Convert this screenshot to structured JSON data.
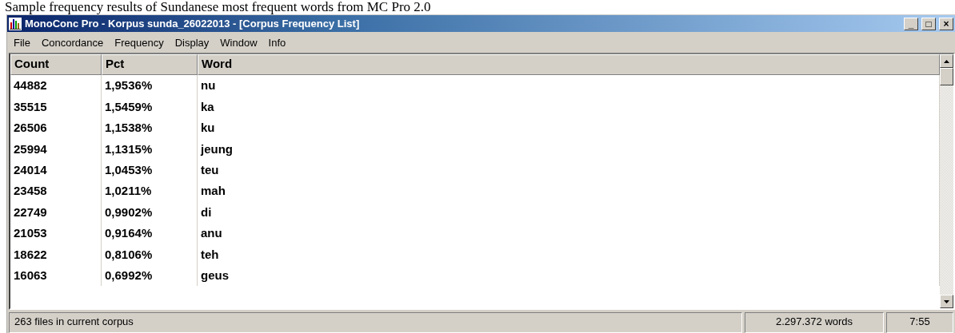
{
  "caption": "Sample frequency results of Sundanese most frequent words from MC Pro 2.0",
  "window": {
    "title": "MonoConc Pro - Korpus sunda_26022013 - [Corpus Frequency List]",
    "controls": [
      "_",
      "□",
      "×"
    ]
  },
  "menu": [
    "File",
    "Concordance",
    "Frequency",
    "Display",
    "Window",
    "Info"
  ],
  "table": {
    "columns": [
      "Count",
      "Pct",
      "Word"
    ],
    "rows": [
      [
        "44882",
        "1,9536%",
        "nu"
      ],
      [
        "35515",
        "1,5459%",
        "ka"
      ],
      [
        "26506",
        "1,1538%",
        "ku"
      ],
      [
        "25994",
        "1,1315%",
        "jeung"
      ],
      [
        "24014",
        "1,0453%",
        "teu"
      ],
      [
        "23458",
        "1,0211%",
        "mah"
      ],
      [
        "22749",
        "0,9902%",
        "di"
      ],
      [
        "21053",
        "0,9164%",
        "anu"
      ],
      [
        "18622",
        "0,8106%",
        "teh"
      ],
      [
        "16063",
        "0,6992%",
        "geus"
      ]
    ]
  },
  "status_bar": [
    "263 files in current corpus",
    "2.297.372 words",
    "7:55"
  ]
}
